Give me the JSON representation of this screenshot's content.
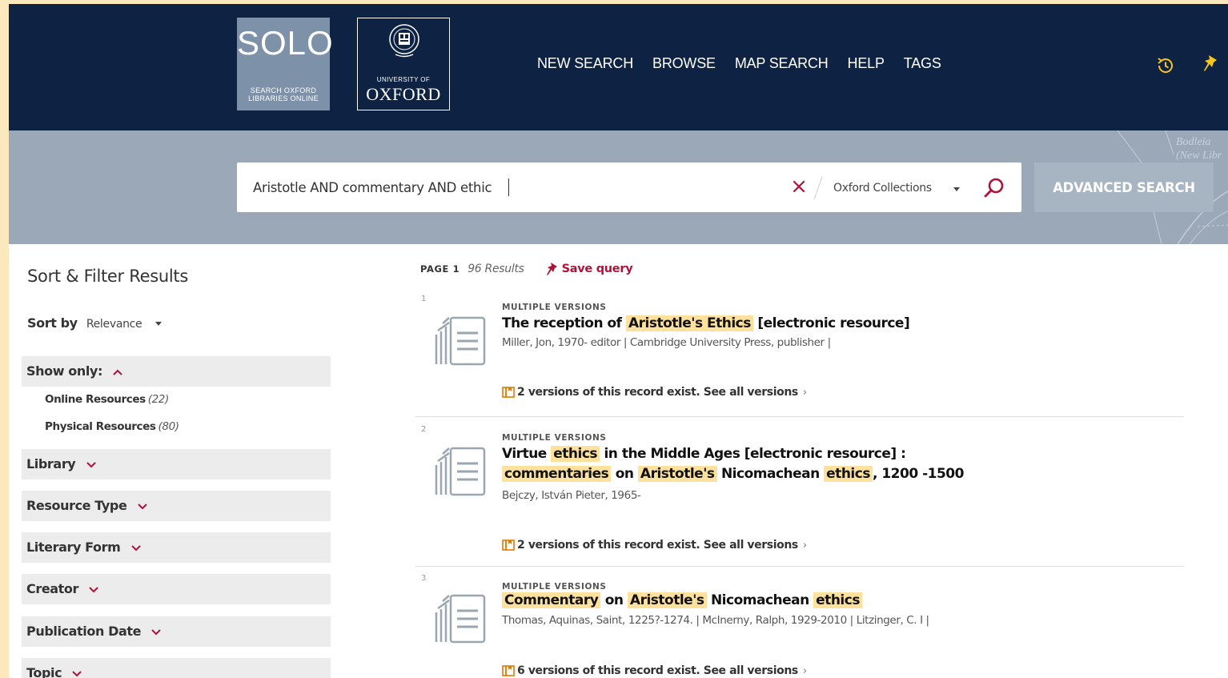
{
  "header": {
    "solo_logo_big": "SOLO",
    "solo_logo_line1": "SEARCH OXFORD",
    "solo_logo_line2": "LIBRARIES ONLINE",
    "oxford_logo_small": "UNIVERSITY OF",
    "oxford_logo_big": "OXFORD",
    "nav": [
      "NEW SEARCH",
      "BROWSE",
      "MAP SEARCH",
      "HELP",
      "TAGS"
    ],
    "icons": [
      "history-icon",
      "pin-icon"
    ]
  },
  "search": {
    "query": "Aristotle AND commentary AND ethic",
    "scope": "Oxford Collections",
    "advanced_label": "ADVANCED SEARCH",
    "banner_text_1": "Bodleia",
    "banner_text_2": "(New Libr"
  },
  "colors": {
    "header_bg": "#0e2243",
    "highlight": "#ffe19e",
    "accent_red": "#b0123a"
  },
  "filters": {
    "title": "Sort & Filter Results",
    "sort_by_label": "Sort by",
    "sort_by_value": "Relevance",
    "show_only_label": "Show only:",
    "show_only_options": [
      {
        "label": "Online Resources",
        "count": "(22)"
      },
      {
        "label": "Physical Resources",
        "count": "(80)"
      }
    ],
    "facets": [
      "Library",
      "Resource Type",
      "Literary Form",
      "Creator",
      "Publication Date",
      "Topic"
    ]
  },
  "results_meta": {
    "page_label": "PAGE 1",
    "count": "96 Results",
    "save_query": "Save query"
  },
  "results": [
    {
      "index": "1",
      "type": "MULTIPLE VERSIONS",
      "title_parts": [
        "The reception of",
        "Aristotle's Ethics",
        "[electronic resource]"
      ],
      "authors": "Miller, Jon, 1970- editor | Cambridge University Press, publisher |",
      "versions": "2 versions of this record exist. See all versions"
    },
    {
      "index": "2",
      "type": "MULTIPLE VERSIONS",
      "title_parts": [
        "Virtue",
        "ethics",
        "in the Middle Ages [electronic resource] :",
        "commentaries",
        "on",
        "Aristotle's",
        "Nicomachean",
        "ethics",
        ", 1200 -1500"
      ],
      "authors": "Bejczy, István Pieter, 1965-",
      "versions": "2 versions of this record exist. See all versions"
    },
    {
      "index": "3",
      "type": "MULTIPLE VERSIONS",
      "title_parts": [
        "Commentary",
        "on",
        "Aristotle's",
        "Nicomachean",
        "ethics"
      ],
      "authors": "Thomas, Aquinas, Saint, 1225?-1274. | McInerny, Ralph, 1929-2010 | Litzinger, C. I |",
      "versions": "6 versions of this record exist. See all versions"
    }
  ]
}
